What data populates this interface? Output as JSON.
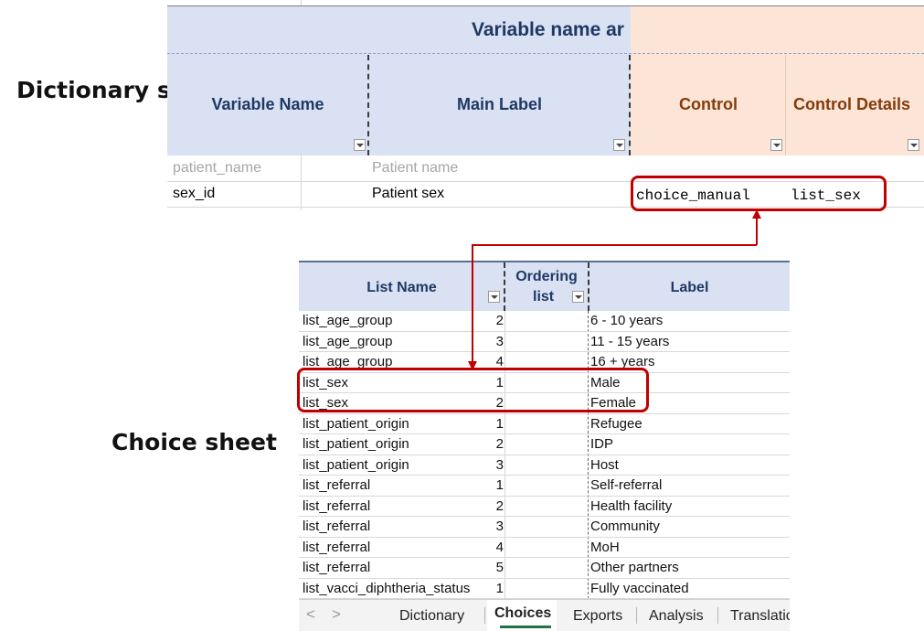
{
  "captions": {
    "dictionary": "Dictionary sheet",
    "choice": "Choice sheet"
  },
  "dictionary": {
    "group_title": "Variable name ar",
    "headers": [
      "Variable Name",
      "Main Label",
      "Control",
      "Control Details"
    ],
    "rows": [
      {
        "variable": "patient_name",
        "label": "Patient name",
        "control": "",
        "details": ""
      },
      {
        "variable": "sex_id",
        "label": "Patient sex",
        "control": "choice_manual",
        "details": "list_sex"
      }
    ]
  },
  "choices": {
    "headers": {
      "list_name": "List Name",
      "ordering_line1": "Ordering",
      "ordering_line2": "list",
      "label": "Label"
    },
    "rows": [
      {
        "list": "list_age_group",
        "order": "2",
        "label": "6 - 10 years"
      },
      {
        "list": "list_age_group",
        "order": "3",
        "label": "11 - 15 years"
      },
      {
        "list": "list_age_group",
        "order": "4",
        "label": "16 + years"
      },
      {
        "list": "list_sex",
        "order": "1",
        "label": "Male"
      },
      {
        "list": "list_sex",
        "order": "2",
        "label": "Female"
      },
      {
        "list": "list_patient_origin",
        "order": "1",
        "label": "Refugee"
      },
      {
        "list": "list_patient_origin",
        "order": "2",
        "label": "IDP"
      },
      {
        "list": "list_patient_origin",
        "order": "3",
        "label": "Host"
      },
      {
        "list": "list_referral",
        "order": "1",
        "label": "Self-referral"
      },
      {
        "list": "list_referral",
        "order": "2",
        "label": "Health facility"
      },
      {
        "list": "list_referral",
        "order": "3",
        "label": "Community"
      },
      {
        "list": "list_referral",
        "order": "4",
        "label": "MoH"
      },
      {
        "list": "list_referral",
        "order": "5",
        "label": "Other partners"
      },
      {
        "list": "list_vacci_diphtheria_status",
        "order": "1",
        "label": "Fully vaccinated"
      }
    ]
  },
  "tabs": {
    "prev": "<",
    "next": ">",
    "items": [
      "Dictionary",
      "Choices",
      "Exports",
      "Analysis",
      "Translatic"
    ],
    "active": "Choices"
  },
  "colors": {
    "highlight": "#c00000",
    "header_blue": "#d9e1f2",
    "header_orange": "#fce4d6",
    "tab_accent": "#217346"
  }
}
